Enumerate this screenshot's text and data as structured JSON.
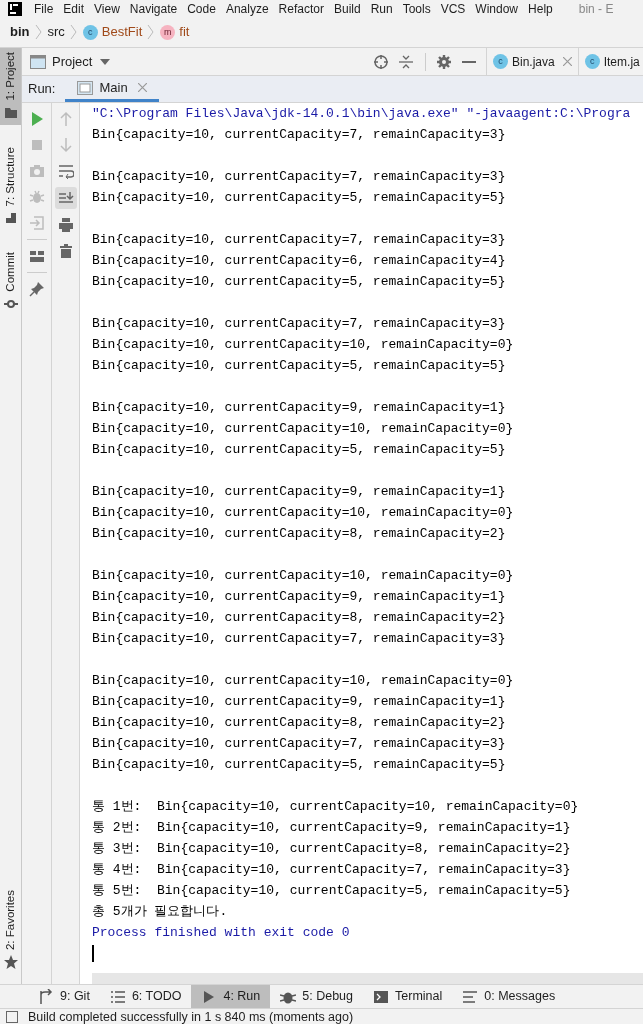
{
  "menu_bar": {
    "items": [
      "File",
      "Edit",
      "View",
      "Navigate",
      "Code",
      "Analyze",
      "Refactor",
      "Build",
      "Run",
      "Tools",
      "VCS",
      "Window",
      "Help"
    ],
    "window_title": "bin - E"
  },
  "breadcrumbs": [
    {
      "label": "bin",
      "kind": "project"
    },
    {
      "label": "src",
      "kind": "folder"
    },
    {
      "label": "BestFit",
      "kind": "class",
      "icon": "c"
    },
    {
      "label": "fit",
      "kind": "method",
      "icon": "m"
    }
  ],
  "left_tool_windows": [
    {
      "label": "1: Project",
      "selected": true,
      "kind": "project"
    },
    {
      "label": "7: Structure",
      "selected": false,
      "kind": "structure"
    },
    {
      "label": "Commit",
      "selected": false,
      "kind": "commit"
    }
  ],
  "left_bottom_tool_windows": [
    {
      "label": "2: Favorites",
      "selected": false,
      "kind": "favorites"
    }
  ],
  "project_panel": {
    "title": "Project"
  },
  "editor_tabs": [
    {
      "label": "Bin.java",
      "closable": true,
      "icon": "c"
    },
    {
      "label": "Item.ja",
      "closable": false,
      "icon": "c"
    }
  ],
  "run_panel": {
    "label": "Run:",
    "tabs": [
      {
        "label": "Main",
        "selected": true
      }
    ]
  },
  "console": {
    "lines": [
      {
        "kind": "command",
        "text": "\"C:\\Program Files\\Java\\jdk-14.0.1\\bin\\java.exe\" \"-javaagent:C:\\Progra"
      },
      {
        "kind": "output",
        "text": "Bin{capacity=10, currentCapacity=7, remainCapacity=3}"
      },
      {
        "kind": "blank"
      },
      {
        "kind": "output",
        "text": "Bin{capacity=10, currentCapacity=7, remainCapacity=3}"
      },
      {
        "kind": "output",
        "text": "Bin{capacity=10, currentCapacity=5, remainCapacity=5}"
      },
      {
        "kind": "blank"
      },
      {
        "kind": "output",
        "text": "Bin{capacity=10, currentCapacity=7, remainCapacity=3}"
      },
      {
        "kind": "output",
        "text": "Bin{capacity=10, currentCapacity=6, remainCapacity=4}"
      },
      {
        "kind": "output",
        "text": "Bin{capacity=10, currentCapacity=5, remainCapacity=5}"
      },
      {
        "kind": "blank"
      },
      {
        "kind": "output",
        "text": "Bin{capacity=10, currentCapacity=7, remainCapacity=3}"
      },
      {
        "kind": "output",
        "text": "Bin{capacity=10, currentCapacity=10, remainCapacity=0}"
      },
      {
        "kind": "output",
        "text": "Bin{capacity=10, currentCapacity=5, remainCapacity=5}"
      },
      {
        "kind": "blank"
      },
      {
        "kind": "output",
        "text": "Bin{capacity=10, currentCapacity=9, remainCapacity=1}"
      },
      {
        "kind": "output",
        "text": "Bin{capacity=10, currentCapacity=10, remainCapacity=0}"
      },
      {
        "kind": "output",
        "text": "Bin{capacity=10, currentCapacity=5, remainCapacity=5}"
      },
      {
        "kind": "blank"
      },
      {
        "kind": "output",
        "text": "Bin{capacity=10, currentCapacity=9, remainCapacity=1}"
      },
      {
        "kind": "output",
        "text": "Bin{capacity=10, currentCapacity=10, remainCapacity=0}"
      },
      {
        "kind": "output",
        "text": "Bin{capacity=10, currentCapacity=8, remainCapacity=2}"
      },
      {
        "kind": "blank"
      },
      {
        "kind": "output",
        "text": "Bin{capacity=10, currentCapacity=10, remainCapacity=0}"
      },
      {
        "kind": "output",
        "text": "Bin{capacity=10, currentCapacity=9, remainCapacity=1}"
      },
      {
        "kind": "output",
        "text": "Bin{capacity=10, currentCapacity=8, remainCapacity=2}"
      },
      {
        "kind": "output",
        "text": "Bin{capacity=10, currentCapacity=7, remainCapacity=3}"
      },
      {
        "kind": "blank"
      },
      {
        "kind": "output",
        "text": "Bin{capacity=10, currentCapacity=10, remainCapacity=0}"
      },
      {
        "kind": "output",
        "text": "Bin{capacity=10, currentCapacity=9, remainCapacity=1}"
      },
      {
        "kind": "output",
        "text": "Bin{capacity=10, currentCapacity=8, remainCapacity=2}"
      },
      {
        "kind": "output",
        "text": "Bin{capacity=10, currentCapacity=7, remainCapacity=3}"
      },
      {
        "kind": "output",
        "text": "Bin{capacity=10, currentCapacity=5, remainCapacity=5}"
      },
      {
        "kind": "blank"
      },
      {
        "kind": "output",
        "text": "통 1번:  Bin{capacity=10, currentCapacity=10, remainCapacity=0}"
      },
      {
        "kind": "output",
        "text": "통 2번:  Bin{capacity=10, currentCapacity=9, remainCapacity=1}"
      },
      {
        "kind": "output",
        "text": "통 3번:  Bin{capacity=10, currentCapacity=8, remainCapacity=2}"
      },
      {
        "kind": "output",
        "text": "통 4번:  Bin{capacity=10, currentCapacity=7, remainCapacity=3}"
      },
      {
        "kind": "output",
        "text": "통 5번:  Bin{capacity=10, currentCapacity=5, remainCapacity=5}"
      },
      {
        "kind": "output",
        "text": "총 5개가 필요합니다."
      },
      {
        "kind": "exit",
        "text": "Process finished with exit code 0"
      },
      {
        "kind": "cursor"
      }
    ]
  },
  "bottom_tool_windows": [
    {
      "label": "9: Git",
      "kind": "git",
      "selected": false
    },
    {
      "label": "6: TODO",
      "kind": "todo",
      "selected": false
    },
    {
      "label": "4: Run",
      "kind": "run",
      "selected": true
    },
    {
      "label": "5: Debug",
      "kind": "debug",
      "selected": false
    },
    {
      "label": "Terminal",
      "kind": "terminal",
      "selected": false
    },
    {
      "label": "0: Messages",
      "kind": "messages",
      "selected": false
    }
  ],
  "status_bar": {
    "message": "Build completed successfully in 1 s 840 ms (moments ago)"
  }
}
